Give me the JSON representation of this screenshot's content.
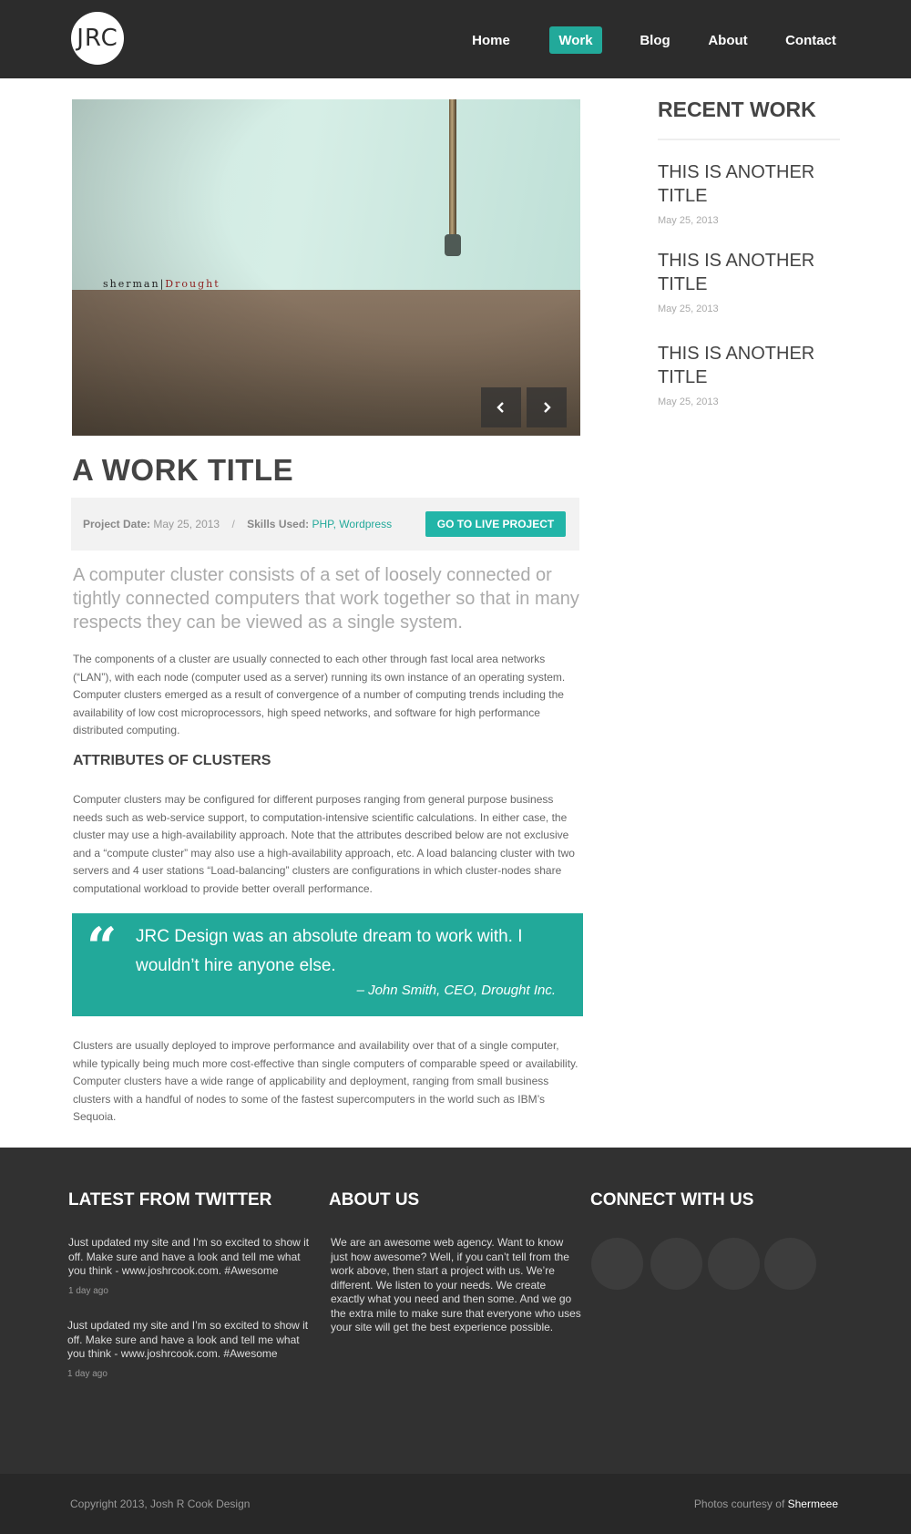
{
  "header": {
    "logo": "JRC",
    "nav": [
      "Home",
      "Work",
      "Blog",
      "About",
      "Contact"
    ],
    "active": "Work"
  },
  "slider": {
    "caption_left": "sherman|",
    "caption_right": "Drought",
    "prev_icon": "chevron-left-icon",
    "next_icon": "chevron-right-icon"
  },
  "work": {
    "title": "A WORK TITLE",
    "project_date_label": "Project Date:",
    "project_date": "May 25, 2013",
    "separator": "/",
    "skills_label": "Skills Used",
    "skills": "PHP, Wordpress",
    "live_button": "GO TO LIVE PROJECT",
    "lead": "A computer cluster consists of a set of loosely connected or tightly connected computers that work together so that in many respects they can be viewed as a single system.",
    "p1": "The components of a cluster are usually connected to each other through fast local area networks (“LAN”), with each node (computer used as a server) running its own instance of an operating system. Computer clusters emerged as a result of convergence of a number of computing trends including the availability of low cost microprocessors, high speed networks, and software for high performance distributed computing.",
    "subheading": "ATTRIBUTES OF CLUSTERS",
    "p2": "Computer clusters may be configured for different purposes ranging from general purpose business needs such as web-service support, to computation-intensive scientific calculations. In either case, the cluster may use a high-availability approach. Note that the attributes described below are not exclusive and a “compute cluster” may also use a high-availability approach, etc. A load balancing cluster with two servers and 4 user stations “Load-balancing” clusters are configurations in which cluster-nodes share computational workload to provide better overall performance.",
    "quote": "JRC Design was an absolute dream to work with. I wouldn’t hire anyone else.",
    "quote_author": "– John Smith, CEO, Drought Inc.",
    "p3": "Clusters are usually deployed to improve performance and availability over that of a single computer, while typically being much more cost-effective than single computers of comparable speed or availability. Computer clusters have a wide range of applicability and deployment, ranging from small business clusters with a handful of nodes to some of the fastest supercomputers in the world such as IBM’s Sequoia."
  },
  "sidebar": {
    "title": "RECENT WORK",
    "items": [
      {
        "title": "THIS IS ANOTHER TITLE",
        "date": "May 25, 2013"
      },
      {
        "title": "THIS IS ANOTHER TITLE",
        "date": "May 25, 2013"
      },
      {
        "title": "THIS IS ANOTHER TITLE",
        "date": "May 25, 2013"
      }
    ]
  },
  "footer": {
    "twitter_title": "LATEST FROM TWITTER",
    "tweets": [
      {
        "text": "Just updated my site and I’m so excited to show it off. Make sure and have a look and tell me what you think - www.joshrcook.com. #Awesome",
        "time": "1 day ago"
      },
      {
        "text": "Just updated my site and I’m so excited to show it off. Make sure and have a look and tell me what you think - www.joshrcook.com. #Awesome",
        "time": "1 day ago"
      }
    ],
    "about_title": "ABOUT US",
    "about_text": "We are an awesome web agency. Want to know just how awesome? Well, if you can’t tell from the work above, then start a project with us. We’re different. We listen to your needs. We create exactly what you need and then some. And we go the extra mile to make sure that everyone who uses your site will get the best experience possible.",
    "connect_title": "CONNECT WITH US",
    "copyright": "Copyright 2013, Josh R Cook Design",
    "credit_prefix": "Photos courtesy of",
    "credit_name": "Shermeee"
  },
  "colors": {
    "accent": "#22a99a",
    "header_bg": "#2c2c2c",
    "footer_bg": "#313131"
  }
}
